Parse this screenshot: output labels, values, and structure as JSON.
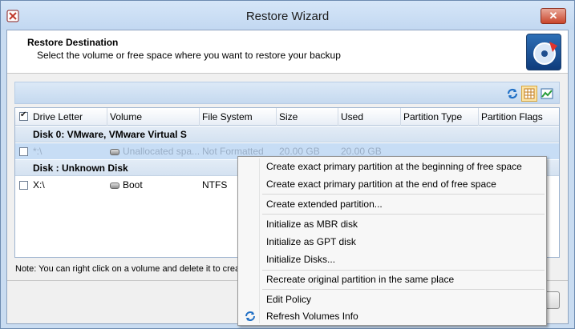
{
  "window": {
    "title": "Restore Wizard",
    "close_label": "✕"
  },
  "header": {
    "title": "Restore Destination",
    "subtitle": "Select the volume or free space where you want to restore your backup"
  },
  "grid": {
    "columns": [
      "Drive Letter",
      "Volume",
      "File System",
      "Size",
      "Used",
      "Partition Type",
      "Partition Flags"
    ],
    "groups": [
      {
        "label": "Disk 0: VMware, VMware Virtual S",
        "rows": [
          {
            "drive": "*:\\",
            "volume": "Unallocated spa...",
            "fs": "Not Formatted",
            "size": "20.00 GB",
            "used": "20.00 GB"
          }
        ]
      },
      {
        "label": "Disk : Unknown Disk",
        "rows": [
          {
            "drive": "X:\\",
            "volume": "Boot",
            "fs": "NTFS",
            "size": "",
            "used": ""
          }
        ]
      }
    ]
  },
  "note": "Note: You can right click on a volume and delete it to creat",
  "context_menu": {
    "items": [
      "Create exact primary partition at the beginning of free space",
      "Create exact primary partition at the end of free space",
      "Create extended partition...",
      "Initialize as MBR disk",
      "Initialize as GPT disk",
      "Initialize Disks...",
      "Recreate original partition in the same place",
      "Edit Policy",
      "Refresh Volumes Info"
    ]
  },
  "colors": {
    "accent": "#c7ddf5",
    "selection_text": "#9aaec6",
    "title_bar": "#c2d8f1"
  }
}
